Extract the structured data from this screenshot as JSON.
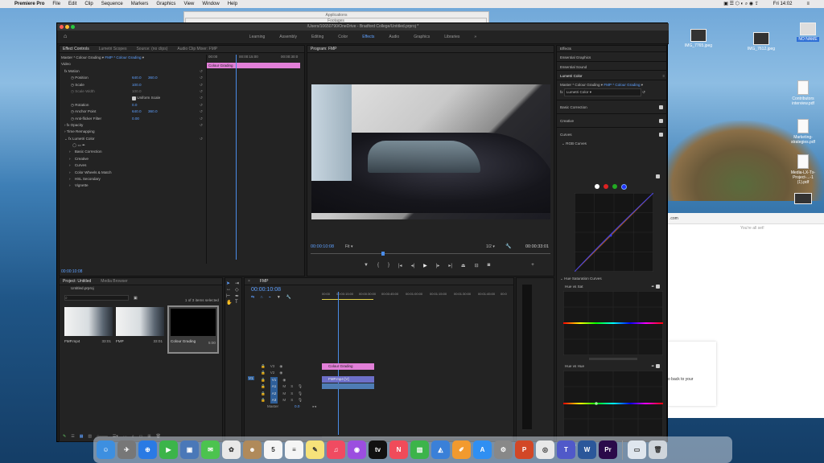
{
  "menubar": {
    "app": "Premiere Pro",
    "items": [
      "File",
      "Edit",
      "Clip",
      "Sequence",
      "Markers",
      "Graphics",
      "View",
      "Window",
      "Help"
    ],
    "clock": "Fri 14:02"
  },
  "bg_windows": {
    "applications": "Applications",
    "footages": "Footages",
    "url_fragment": ".com",
    "settings_text": "You're all set!",
    "go_back_text": "o back to your"
  },
  "desktop_icons": [
    {
      "label": "IMG_7765.jpeg",
      "kind": "image"
    },
    {
      "label": "IMG_7612.jpeg",
      "kind": "image"
    },
    {
      "label": "NO NAME",
      "kind": "drive"
    },
    {
      "label": "Contributors interview.pdf",
      "kind": "doc"
    },
    {
      "label": "Marketing-strategies.pdf",
      "kind": "doc"
    },
    {
      "label": "Media-LX-Tx-Project-...-1 (1).pdf",
      "kind": "doc"
    },
    {
      "label": "",
      "kind": "image"
    }
  ],
  "premiere": {
    "window_title": "/Users/10650790/OneDrive - Bradford College/Untitled.prproj *",
    "workspaces": [
      "Learning",
      "Assembly",
      "Editing",
      "Color",
      "Effects",
      "Audio",
      "Graphics",
      "Libraries"
    ],
    "active_workspace": "Effects",
    "effect_controls": {
      "tabs": [
        "Effect Controls",
        "Lumetri Scopes",
        "Source: (no clips)",
        "Audio Clip Mixer: FMP"
      ],
      "master": "Master * Colour Grading",
      "clip": "FMP * Colour Grading",
      "ruler": [
        "00:00",
        "00:00:15:00",
        "00:00:30:0"
      ],
      "clip_bar": "Colour Grading",
      "rows": [
        {
          "label": "Video",
          "v1": "",
          "v2": ""
        },
        {
          "label": "fx  Motion",
          "v1": "",
          "v2": ""
        },
        {
          "label": "Position",
          "v1": "640.0",
          "v2": "360.0"
        },
        {
          "label": "Scale",
          "v1": "100.0",
          "v2": ""
        },
        {
          "label": "Scale Width",
          "v1": "100.0",
          "v2": ""
        },
        {
          "label": "Uniform Scale",
          "v1": "",
          "v2": ""
        },
        {
          "label": "Rotation",
          "v1": "0.0",
          "v2": ""
        },
        {
          "label": "Anchor Point",
          "v1": "640.0",
          "v2": "360.0"
        },
        {
          "label": "Anti-flicker Filter",
          "v1": "0.00",
          "v2": ""
        },
        {
          "label": "fx  Opacity",
          "v1": "",
          "v2": ""
        },
        {
          "label": "Time Remapping",
          "v1": "",
          "v2": ""
        },
        {
          "label": "fx  Lumetri Color",
          "v1": "",
          "v2": ""
        },
        {
          "label": "",
          "v1": "",
          "v2": ""
        },
        {
          "label": "Basic Correction",
          "v1": "",
          "v2": ""
        },
        {
          "label": "Creative",
          "v1": "",
          "v2": ""
        },
        {
          "label": "Curves",
          "v1": "",
          "v2": ""
        },
        {
          "label": "Color Wheels & Match",
          "v1": "",
          "v2": ""
        },
        {
          "label": "HSL Secondary",
          "v1": "",
          "v2": ""
        },
        {
          "label": "Vignette",
          "v1": "",
          "v2": ""
        }
      ],
      "timecode": "00:00:10:08"
    },
    "program": {
      "title": "Program: FMP",
      "timecode": "00:00:10:08",
      "fit": "Fit",
      "quality": "1/2",
      "duration": "00:00:33:01"
    },
    "project": {
      "tabs": [
        "Project: Untitled",
        "Media Browser"
      ],
      "file": "Untitled.prproj",
      "selection": "1 of 3 items selected",
      "items": [
        {
          "name": "FMP.mp4",
          "dur": "33:01"
        },
        {
          "name": "FMP",
          "dur": "33:01"
        },
        {
          "name": "Colour Grading",
          "dur": "5:00"
        }
      ]
    },
    "timeline": {
      "tab": "FMP",
      "timecode": "00:00:10:08",
      "ruler": [
        "00:00",
        "00:00:15:00",
        "00:00:30:00",
        "00:00:45:00",
        "00:01:00:00",
        "00:01:15:00",
        "00:01:30:00",
        "00:01:45:00",
        "00:0"
      ],
      "tracks": [
        "V3",
        "V2",
        "V1",
        "A1",
        "A2",
        "A3",
        "Master"
      ],
      "master_value": "0.0",
      "clip_v3": "Colour Grading",
      "clip_v1": "FMP.mp4 [V]"
    },
    "meter_scale": [
      "0",
      "-6",
      "-12",
      "-18",
      "-24",
      "-30",
      "-36",
      "-42",
      "-48",
      "-54",
      "dB"
    ],
    "right_panels": {
      "headers": [
        "Effects",
        "Essential Graphics",
        "Essential Sound",
        "Lumetri Color"
      ],
      "master": "Master * Colour Grading",
      "clip": "FMP * Colour Grading",
      "effect_select": "Lumetri Color",
      "sections": [
        "Basic Correction",
        "Creative",
        "Curves"
      ],
      "rgb_curves": "RGB Curves",
      "hue_sat_curves": "Hue Saturation Curves",
      "hue_vs_sat": "Hue vs Sat",
      "hue_vs_hue": "Hue vs Hue",
      "hue_vs_luma": "Hue vs Luma"
    }
  },
  "dock": [
    {
      "name": "Finder",
      "color": "#3d8fe0",
      "glyph": "☺"
    },
    {
      "name": "Launchpad",
      "color": "#777",
      "glyph": "✈"
    },
    {
      "name": "Safari",
      "color": "#2a7ae4",
      "glyph": "⊕"
    },
    {
      "name": "FaceTime",
      "color": "#3cb44a",
      "glyph": "▶"
    },
    {
      "name": "Preview",
      "color": "#4a78b8",
      "glyph": "▣"
    },
    {
      "name": "Messages",
      "color": "#4cc34f",
      "glyph": "✉"
    },
    {
      "name": "Photos",
      "color": "#e8e8e8",
      "glyph": "✿"
    },
    {
      "name": "Contacts",
      "color": "#b08a5a",
      "glyph": "☻"
    },
    {
      "name": "Calendar",
      "color": "#f5f5f5",
      "glyph": "5"
    },
    {
      "name": "Reminders",
      "color": "#f5f5f5",
      "glyph": "≡"
    },
    {
      "name": "Notes",
      "color": "#f6e27a",
      "glyph": "✎"
    },
    {
      "name": "Music",
      "color": "#f04b61",
      "glyph": "♫"
    },
    {
      "name": "Podcasts",
      "color": "#9b4ee0",
      "glyph": "◉"
    },
    {
      "name": "TV",
      "color": "#111",
      "glyph": "tv"
    },
    {
      "name": "News",
      "color": "#f04b5a",
      "glyph": "N"
    },
    {
      "name": "Numbers",
      "color": "#3cb44a",
      "glyph": "▥"
    },
    {
      "name": "Keynote",
      "color": "#3a80d8",
      "glyph": "◭"
    },
    {
      "name": "Pages",
      "color": "#f29a2e",
      "glyph": "✐"
    },
    {
      "name": "App Store",
      "color": "#2f8ff2",
      "glyph": "A"
    },
    {
      "name": "System Preferences",
      "color": "#888",
      "glyph": "⚙"
    },
    {
      "name": "PowerPoint",
      "color": "#d24726",
      "glyph": "P"
    },
    {
      "name": "Chrome",
      "color": "#e8e8e8",
      "glyph": "◎"
    },
    {
      "name": "Teams",
      "color": "#5059c9",
      "glyph": "T"
    },
    {
      "name": "Word",
      "color": "#2b579a",
      "glyph": "W"
    },
    {
      "name": "Premiere Pro",
      "color": "#2a0a4a",
      "glyph": "Pr"
    },
    {
      "name": "Downloads",
      "color": "#dfe6ee",
      "glyph": "▭"
    },
    {
      "name": "Trash",
      "color": "#cfd5db",
      "glyph": "🗑"
    }
  ]
}
